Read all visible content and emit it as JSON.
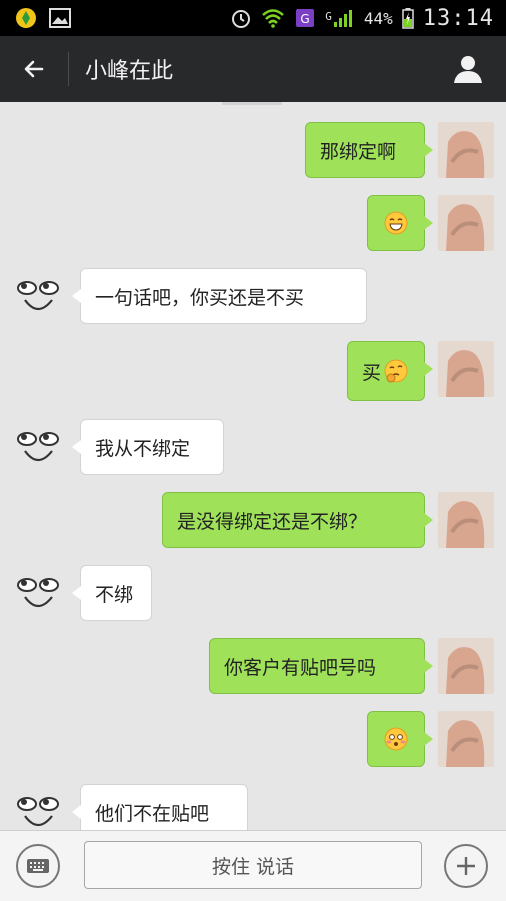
{
  "status_bar": {
    "battery_percent": "44%",
    "time": "13:14",
    "network": "G",
    "icons": [
      "app-icon",
      "image-icon",
      "alarm-icon",
      "wifi-icon",
      "g-badge-icon",
      "signal-icon",
      "battery-charging-icon"
    ]
  },
  "header": {
    "title": "小峰在此",
    "back_icon": "arrow-left-icon",
    "profile_icon": "person-icon"
  },
  "messages": [
    {
      "from": "me",
      "text": "那绑定啊"
    },
    {
      "from": "me",
      "text": "",
      "emoji": "grin-emoji"
    },
    {
      "from": "friend",
      "text": "一句话吧，你买还是不买"
    },
    {
      "from": "me",
      "text": "买",
      "emoji": "thinking-emoji"
    },
    {
      "from": "friend",
      "text": "我从不绑定"
    },
    {
      "from": "me",
      "text": "是没得绑定还是不绑？"
    },
    {
      "from": "friend",
      "text": "不绑"
    },
    {
      "from": "me",
      "text": "你客户有贴吧号吗"
    },
    {
      "from": "me",
      "text": "",
      "emoji": "flushed-emoji"
    },
    {
      "from": "friend",
      "text": "他们不在贴吧"
    }
  ],
  "input_bar": {
    "hold_to_talk": "按住 说话",
    "keyboard_icon": "keyboard-icon",
    "plus_icon": "plus-icon"
  },
  "colors": {
    "my_bubble": "#9fe25a",
    "friend_bubble": "#ffffff",
    "header_bg": "#27292b",
    "chat_bg": "#e6e6e6"
  }
}
